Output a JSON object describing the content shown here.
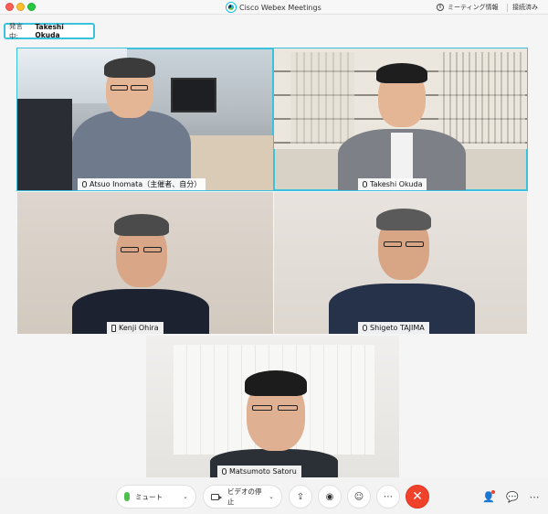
{
  "window": {
    "title": "Cisco Webex Meetings",
    "info_label": "ミーティング情報",
    "connection_status": "接続済み"
  },
  "speaking": {
    "label": "発言中:",
    "name": "Takeshi Okuda"
  },
  "participants": [
    {
      "name": "Atsuo Inomata（主催者、自分）",
      "audio_icon": "mic-icon",
      "active": true
    },
    {
      "name": "Takeshi Okuda",
      "audio_icon": "mic-icon",
      "active": true
    },
    {
      "name": "Kenji Ohira",
      "audio_icon": "phone-icon",
      "active": false
    },
    {
      "name": "Shigeto TAJIMA",
      "audio_icon": "mic-icon",
      "active": false
    },
    {
      "name": "Matsumoto  Satoru",
      "audio_icon": "mic-icon",
      "active": false
    }
  ],
  "toolbar": {
    "mute_label": "ミュート",
    "video_label": "ビデオの停止",
    "share_icon": "share-icon",
    "record_icon": "record-icon",
    "reactions_icon": "reactions-icon",
    "more_icon": "more-icon",
    "end_icon": "end-call-icon",
    "participants_icon": "participants-icon",
    "chat_icon": "chat-icon"
  },
  "colors": {
    "active_border": "#39c1de",
    "end_call": "#f0412b",
    "mic_on": "#4ec04b"
  }
}
